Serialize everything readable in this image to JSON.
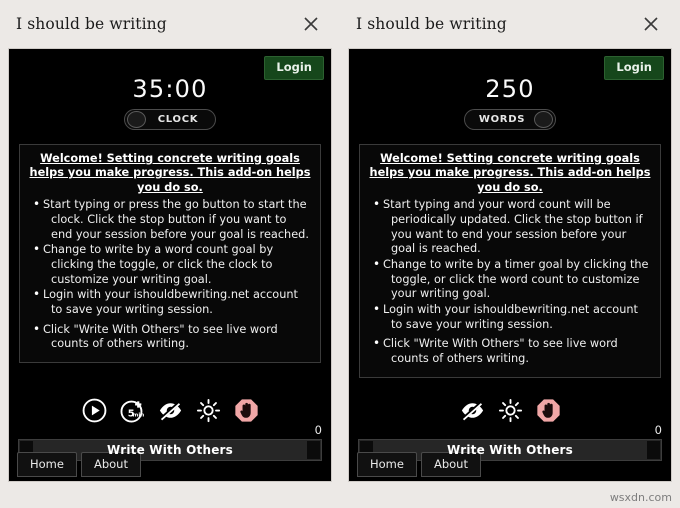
{
  "watermark": "wsxdn.com",
  "panels": [
    {
      "key": "clock-panel",
      "title": "I should be writing",
      "close_icon": "close-icon",
      "login_label": "Login",
      "goal_value": "35:00",
      "toggle_label": "CLOCK",
      "toggle_mode": "clock",
      "instructions_heading": "Welcome! Setting concrete writing goals helps you make progress. This add-on helps you do so.",
      "instructions": [
        "Start typing or press the go button to start the clock. Click the stop button if you want to end your session before your goal is reached.",
        "Change to write by a word count goal by clicking the toggle, or click the clock to customize your writing goal.",
        "Login with your ishouldbewriting.net account to save your writing session.",
        "Click \"Write With Others\" to see live word counts of others writing."
      ],
      "icons": [
        "play-icon",
        "add-five-minutes-icon",
        "eye-off-icon",
        "brightness-icon",
        "stop-hand-icon"
      ],
      "progress_count": "0",
      "write_with_others_label": "Write With Others",
      "tabs": [
        "Home",
        "About"
      ]
    },
    {
      "key": "words-panel",
      "title": "I should be writing",
      "close_icon": "close-icon",
      "login_label": "Login",
      "goal_value": "250",
      "toggle_label": "WORDS",
      "toggle_mode": "words",
      "instructions_heading": "Welcome! Setting concrete writing goals helps you make progress. This add-on helps you do so.",
      "instructions": [
        "Start typing and your word count will be periodically updated. Click the stop button if you want to end your session before your goal is reached.",
        "Change to write by a timer goal by clicking the toggle, or click the word count to customize your writing goal.",
        "Login with your ishouldbewriting.net account to save your writing session.",
        "Click \"Write With Others\" to see live word counts of others writing."
      ],
      "icons": [
        "eye-off-icon",
        "brightness-icon",
        "stop-hand-icon"
      ],
      "progress_count": "0",
      "write_with_others_label": "Write With Others",
      "tabs": [
        "Home",
        "About"
      ]
    }
  ],
  "colors": {
    "page_background": "#ece9e6",
    "addon_background": "#000000",
    "login_green": "#16471b",
    "stop_red": "#f0a6a6",
    "text_light": "#f2f2f2"
  }
}
